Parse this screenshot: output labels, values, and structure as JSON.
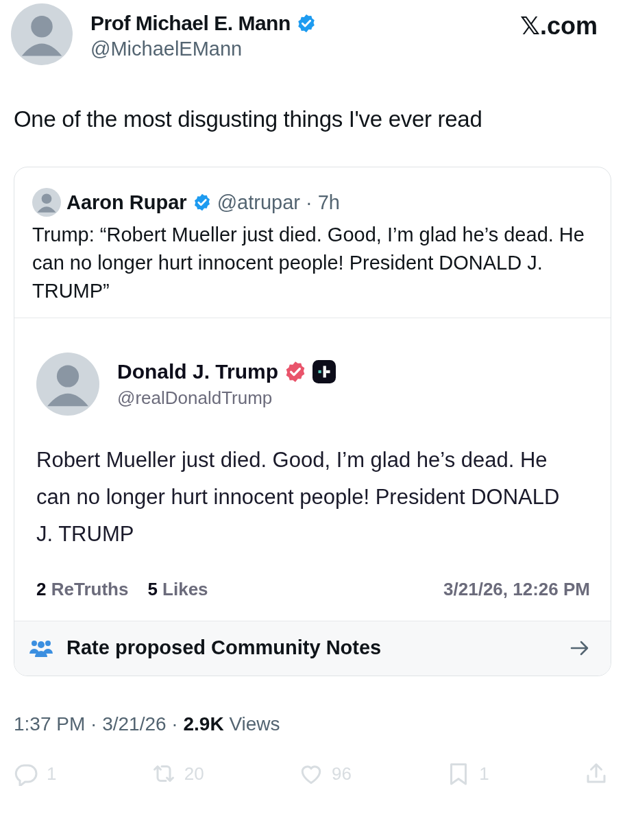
{
  "author": {
    "name": "Prof Michael E. Mann",
    "handle": "@MichaelEMann",
    "verified": true
  },
  "site_label": "𝕏.com",
  "text": "One of the most disgusting things I've ever read",
  "quote": {
    "name": "Aaron Rupar",
    "verified": true,
    "handle": "@atrupar",
    "separator": "·",
    "age": "7h",
    "text": "Trump: “Robert Mueller just died. Good, I’m glad he’s dead. He can no longer hurt innocent people! President DONALD J. TRUMP”",
    "embed": {
      "name": "Donald J. Trump",
      "verified": true,
      "handle": "@realDonaldTrump",
      "text": "Robert Mueller just died. Good, I’m glad he’s dead. He can no longer hurt innocent people! President DONALD J. TRUMP",
      "stats": [
        "**2** ReTruths",
        "**5** Likes"
      ],
      "timestamp": "3/21/26, 12:26 PM"
    },
    "notes_link": "Rate proposed Community Notes"
  },
  "meta": "1:37 PM · 3/21/26 · **2.9K** Views",
  "actions": [
    {
      "kind": "reply",
      "count": "1"
    },
    {
      "kind": "retweet",
      "count": "20"
    },
    {
      "kind": "like",
      "count": "96"
    },
    {
      "kind": "bookmark",
      "count": "1"
    },
    {
      "kind": "share"
    }
  ]
}
